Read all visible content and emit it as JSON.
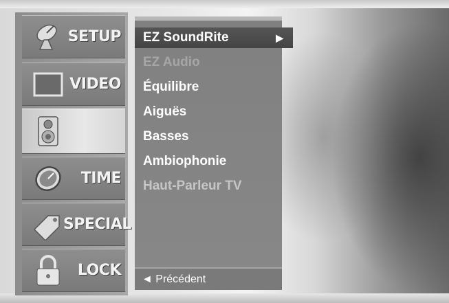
{
  "sidebar": {
    "items": [
      {
        "label": "SETUP",
        "icon": "satellite-dish-icon"
      },
      {
        "label": "VIDEO",
        "icon": "picture-icon"
      },
      {
        "label": "",
        "icon": "speaker-icon"
      },
      {
        "label": "TIME",
        "icon": "clock-icon"
      },
      {
        "label": "SPECIAL",
        "icon": "tag-icon"
      },
      {
        "label": "LOCK",
        "icon": "padlock-icon"
      }
    ]
  },
  "menu": {
    "items": [
      {
        "label": "EZ SoundRite",
        "state": "selected",
        "arrow": "▶"
      },
      {
        "label": "EZ Audio",
        "state": "disabled"
      },
      {
        "label": "Équilibre",
        "state": "normal"
      },
      {
        "label": "Aiguës",
        "state": "normal"
      },
      {
        "label": "Basses",
        "state": "normal"
      },
      {
        "label": "Ambiophonie",
        "state": "normal"
      },
      {
        "label": "Haut-Parleur TV",
        "state": "dim"
      }
    ],
    "back_label": "◄ Précédent"
  },
  "colors": {
    "panel": "#808080",
    "selected": "#4a4a4a",
    "text": "#ffffff",
    "disabled": "#a6a6a6"
  }
}
